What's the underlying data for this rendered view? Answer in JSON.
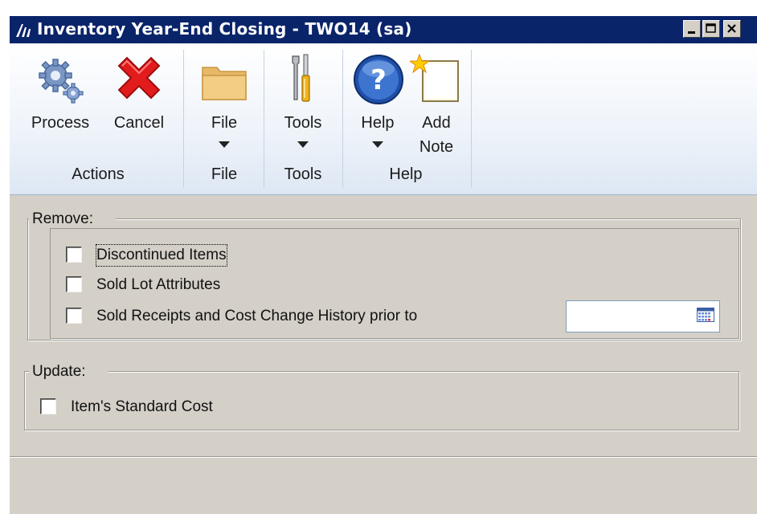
{
  "window": {
    "title": "Inventory Year-End Closing  -  TWO14 (sa)"
  },
  "ribbon": {
    "groups": [
      {
        "name": "Actions",
        "buttons": [
          {
            "label": "Process",
            "icon": "gears-icon"
          },
          {
            "label": "Cancel",
            "icon": "red-x-icon"
          }
        ]
      },
      {
        "name": "File",
        "buttons": [
          {
            "label": "File",
            "icon": "folder-icon"
          }
        ]
      },
      {
        "name": "Tools",
        "buttons": [
          {
            "label": "Tools",
            "icon": "tools-icon"
          }
        ]
      },
      {
        "name": "Help",
        "buttons": [
          {
            "label": "Help",
            "icon": "help-icon"
          },
          {
            "label_line1": "Add",
            "label_line2": "Note",
            "icon": "note-icon"
          }
        ]
      }
    ]
  },
  "remove": {
    "label": "Remove:",
    "options": [
      {
        "label": "Discontinued Items",
        "checked": false
      },
      {
        "label": "Sold Lot Attributes",
        "checked": false
      },
      {
        "label": "Sold Receipts and Cost Change History prior to",
        "checked": false
      }
    ],
    "date_value": ""
  },
  "update": {
    "label": "Update:",
    "options": [
      {
        "label": "Item's Standard Cost",
        "checked": false
      }
    ]
  },
  "colors": {
    "titlebar": "#0a246a",
    "window_bg": "#d4d0c8",
    "ribbon_bg": "#eef3fa"
  }
}
